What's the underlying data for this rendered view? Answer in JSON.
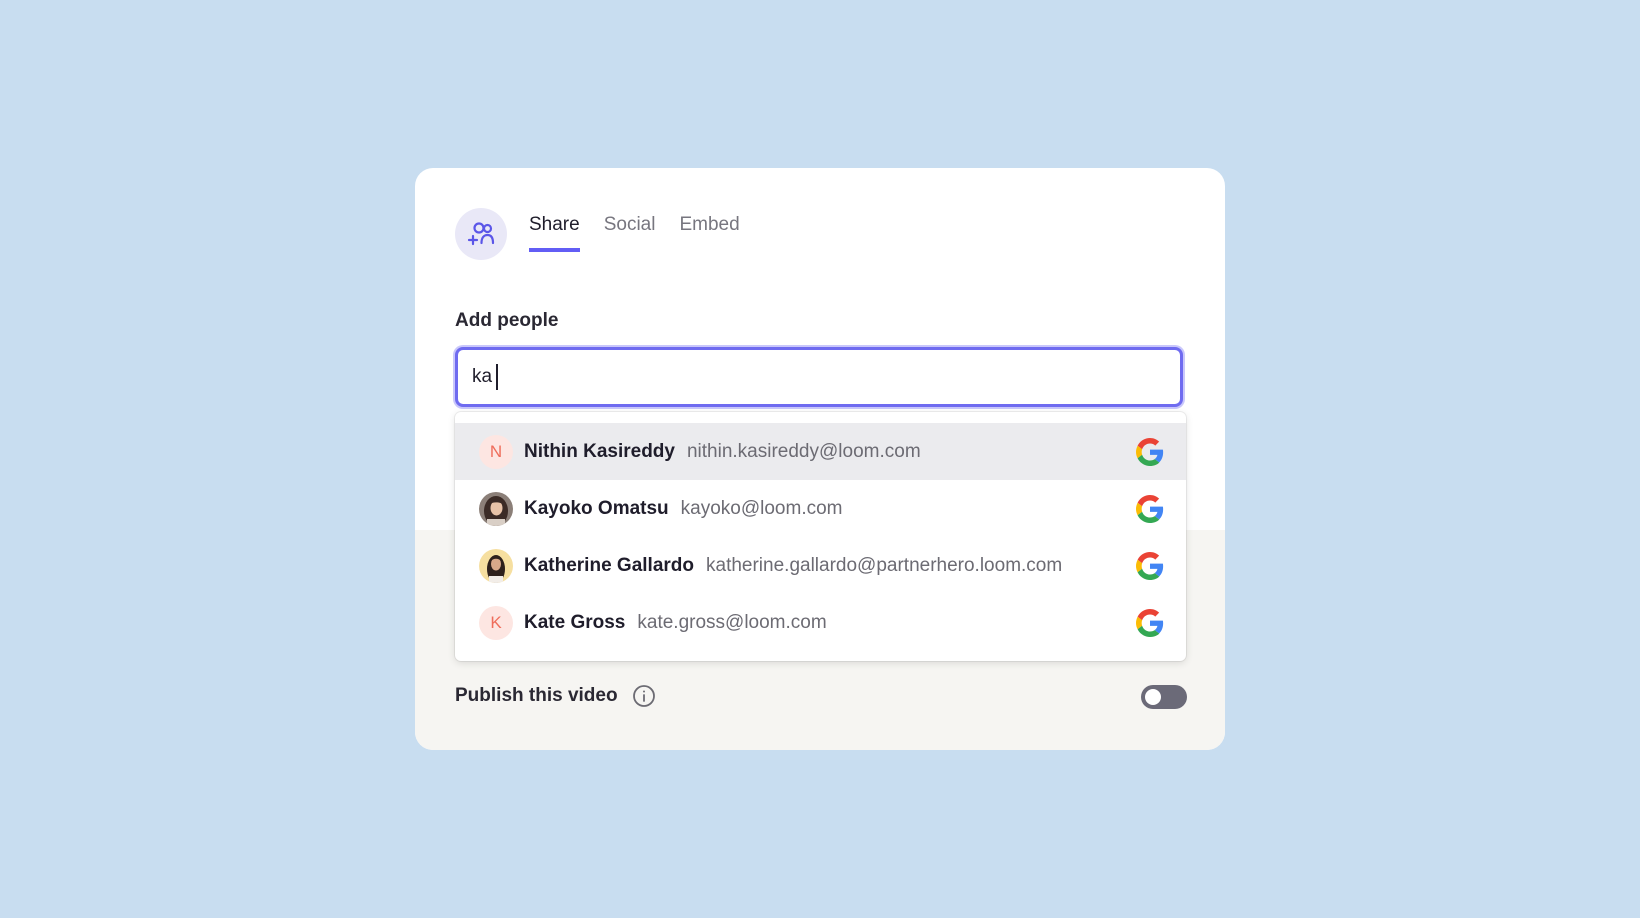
{
  "tabs": [
    {
      "label": "Share",
      "active": true
    },
    {
      "label": "Social",
      "active": false
    },
    {
      "label": "Embed",
      "active": false
    }
  ],
  "add_people": {
    "label": "Add people",
    "value": "ka"
  },
  "suggestions": [
    {
      "name": "Nithin Kasireddy",
      "email": "nithin.kasireddy@loom.com",
      "avatar": "N",
      "avatar_type": "initial",
      "highlighted": true,
      "source_icon": "google-icon"
    },
    {
      "name": "Kayoko Omatsu",
      "email": "kayoko@loom.com",
      "avatar": "photo",
      "avatar_type": "photo",
      "highlighted": false,
      "source_icon": "google-icon"
    },
    {
      "name": "Katherine Gallardo",
      "email": "katherine.gallardo@partnerhero.loom.com",
      "avatar": "photo",
      "avatar_type": "photo",
      "highlighted": false,
      "source_icon": "google-icon"
    },
    {
      "name": "Kate Gross",
      "email": "kate.gross@loom.com",
      "avatar": "K",
      "avatar_type": "initial",
      "highlighted": false,
      "source_icon": "google-icon"
    }
  ],
  "publish": {
    "label": "Publish this video",
    "enabled": false
  },
  "colors": {
    "accent": "#625df5",
    "background": "#c8ddf0",
    "toggle_off": "#6b6a78"
  }
}
